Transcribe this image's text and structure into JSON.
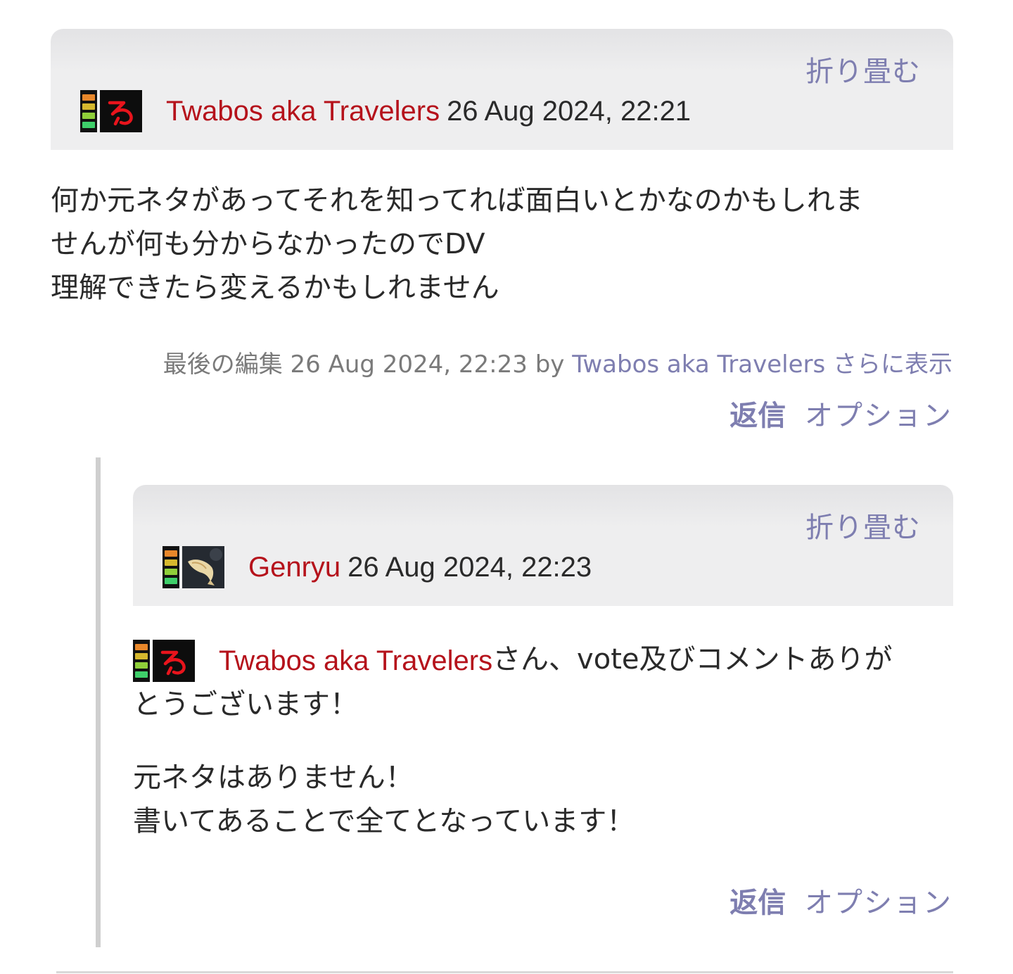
{
  "comments": [
    {
      "collapse_label": "折り畳む",
      "author": "Twabos aka Travelers",
      "timestamp": "26 Aug 2024, 22:21",
      "body_lines": [
        "何か元ネタがあってそれを知ってれば面白いとかなのかもしれま",
        "せんが何も分からなかったのでDV",
        "理解できたら変えるかもしれません"
      ],
      "edit": {
        "prefix": "最後の編集 26 Aug 2024, 22:23 by",
        "author": "Twabos aka Travelers",
        "more_label": "さらに表示"
      },
      "reply_label": "返信",
      "options_label": "オプション",
      "avatar_icon": "red-hiragana-ro-icon"
    },
    {
      "collapse_label": "折り畳む",
      "author": "Genryu",
      "timestamp": "26 Aug 2024, 22:23",
      "mention": "Twabos aka Travelers",
      "body_line1_rest": "さん、vote及びコメントありが",
      "body_line2": "とうございます！",
      "body_para2_line1": "元ネタはありません！",
      "body_para2_line2": "書いてあることで全てとなっています！",
      "reply_label": "返信",
      "options_label": "オプション",
      "avatar_icon": "koi-fish-icon"
    }
  ],
  "colors": {
    "username": "#b5121b",
    "link": "#7e7eb0",
    "header_bg": "#eeeeef",
    "thread_line": "#cfcfcf"
  }
}
